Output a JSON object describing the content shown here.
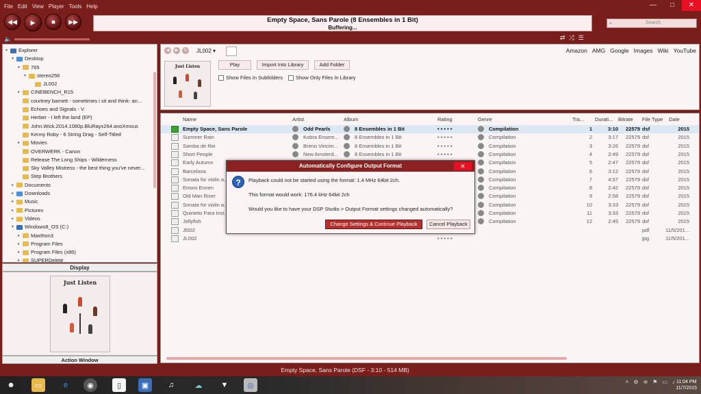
{
  "menu": [
    "File",
    "Edit",
    "View",
    "Player",
    "Tools",
    "Help"
  ],
  "window_controls": {
    "minimize": "—",
    "maximize": "□",
    "close": "✕"
  },
  "transport": {
    "prev": "◀◀",
    "play": "▶",
    "stop": "■",
    "next": "▶▶"
  },
  "now_playing": {
    "title": "Empty Space, Sans Parole (8 Ensembles in 1 Bit)",
    "status": "Buffering..."
  },
  "search": {
    "placeholder": "Search"
  },
  "tree": [
    {
      "label": "Explorer",
      "indent": 0,
      "type": "pc",
      "arrow": "▾"
    },
    {
      "label": "Desktop",
      "indent": 1,
      "type": "blue",
      "arrow": "▾"
    },
    {
      "label": "765",
      "indent": 2,
      "type": "folder",
      "arrow": "▾"
    },
    {
      "label": "stereo256",
      "indent": 3,
      "type": "folder",
      "arrow": "▾"
    },
    {
      "label": "JL002",
      "indent": 4,
      "type": "folder",
      "arrow": ""
    },
    {
      "label": "CINEBENCH_R15",
      "indent": 2,
      "type": "folder",
      "arrow": "▸"
    },
    {
      "label": "courtney barnett - sometimes i sit and think- an...",
      "indent": 2,
      "type": "folder",
      "arrow": ""
    },
    {
      "label": "Echoes and Signals - V",
      "indent": 2,
      "type": "folder",
      "arrow": ""
    },
    {
      "label": "Herber - I left the land (EP)",
      "indent": 2,
      "type": "folder",
      "arrow": ""
    },
    {
      "label": "John.Wick.2014.1080p.BluRayx264.anoXmous",
      "indent": 2,
      "type": "folder",
      "arrow": ""
    },
    {
      "label": "Kenny Roby - 6 String Drag - Self-Titled",
      "indent": 2,
      "type": "folder",
      "arrow": ""
    },
    {
      "label": "Movies",
      "indent": 2,
      "type": "folder",
      "arrow": "▸"
    },
    {
      "label": "OVERWERK - Canon",
      "indent": 2,
      "type": "folder",
      "arrow": ""
    },
    {
      "label": "Release The Long Ships - Wilderness",
      "indent": 2,
      "type": "folder",
      "arrow": ""
    },
    {
      "label": "Sky Valley Mistress - the best thing you've never...",
      "indent": 2,
      "type": "folder",
      "arrow": ""
    },
    {
      "label": "Step Brothers",
      "indent": 2,
      "type": "folder",
      "arrow": ""
    },
    {
      "label": "Documents",
      "indent": 1,
      "type": "folder",
      "arrow": "▸"
    },
    {
      "label": "Downloads",
      "indent": 1,
      "type": "blue",
      "arrow": "▸"
    },
    {
      "label": "Music",
      "indent": 1,
      "type": "folder",
      "arrow": "▸"
    },
    {
      "label": "Pictures",
      "indent": 1,
      "type": "folder",
      "arrow": "▸"
    },
    {
      "label": "Videos",
      "indent": 1,
      "type": "folder",
      "arrow": "▸"
    },
    {
      "label": "Windows8_OS (C:)",
      "indent": 1,
      "type": "pc",
      "arrow": "▾"
    },
    {
      "label": "Maxthon3",
      "indent": 2,
      "type": "folder",
      "arrow": "▸"
    },
    {
      "label": "Program Files",
      "indent": 2,
      "type": "folder",
      "arrow": "▸"
    },
    {
      "label": "Program Files (x86)",
      "indent": 2,
      "type": "folder",
      "arrow": "▸"
    },
    {
      "label": "SUPERDelete",
      "indent": 2,
      "type": "folder",
      "arrow": "▸"
    }
  ],
  "display_panel": {
    "title": "Display",
    "action_title": "Action Window"
  },
  "cover": {
    "title": "Just Listen"
  },
  "breadcrumb": "JL002 ▾",
  "links": [
    "Amazon",
    "AMG",
    "Google",
    "Images",
    "Wiki",
    "YouTube"
  ],
  "buttons": {
    "play": "Play",
    "import": "Import Into Library",
    "add_folder": "Add Folder"
  },
  "checks": {
    "subfolders": "Show Files In Subfolders",
    "only_library": "Show Only Files In Library"
  },
  "columns": {
    "name": "Name",
    "artist": "Artist",
    "album": "Album",
    "rating": "Rating",
    "genre": "Genre",
    "track": "Tra...",
    "duration": "Durati...",
    "bitrate": "Bitrate",
    "filetype": "File Type",
    "date": "Date"
  },
  "tracks": [
    {
      "name": "Empty Space, Sans Parole",
      "artist": "Odd Pearls",
      "album": "8 Ensembles in 1 Bit",
      "rating": "• • • • •",
      "genre": "Compilation",
      "track": "1",
      "duration": "3:10",
      "bitrate": "22579",
      "type": "dsf",
      "date": "2015"
    },
    {
      "name": "Summer Rain",
      "artist": "Kobra Ensem...",
      "album": "8 Ensembles in 1 Bit",
      "rating": "• • • • •",
      "genre": "Compilation",
      "track": "2",
      "duration": "3:17",
      "bitrate": "22579",
      "type": "dsf",
      "date": "2015"
    },
    {
      "name": "Samba de Rei",
      "artist": "Breno Viricim...",
      "album": "8 Ensembles in 1 Bit",
      "rating": "• • • • •",
      "genre": "Compilation",
      "track": "3",
      "duration": "3:26",
      "bitrate": "22579",
      "type": "dsf",
      "date": "2015"
    },
    {
      "name": "Short People",
      "artist": "New Amsterd...",
      "album": "8 Ensembles in 1 Bit",
      "rating": "• • • • •",
      "genre": "Compilation",
      "track": "4",
      "duration": "2:49",
      "bitrate": "22579",
      "type": "dsf",
      "date": "2015"
    },
    {
      "name": "Early Autumn",
      "artist": "",
      "album": "",
      "rating": "",
      "genre": "Compilation",
      "track": "5",
      "duration": "2:47",
      "bitrate": "22579",
      "type": "dsf",
      "date": "2015"
    },
    {
      "name": "Barcelona",
      "artist": "",
      "album": "",
      "rating": "",
      "genre": "Compilation",
      "track": "6",
      "duration": "3:12",
      "bitrate": "22579",
      "type": "dsf",
      "date": "2015"
    },
    {
      "name": "Sonata for violin a...",
      "artist": "",
      "album": "",
      "rating": "",
      "genre": "Compilation",
      "track": "7",
      "duration": "4:57",
      "bitrate": "22579",
      "type": "dsf",
      "date": "2015"
    },
    {
      "name": "Emoni Ennen",
      "artist": "",
      "album": "",
      "rating": "",
      "genre": "Compilation",
      "track": "8",
      "duration": "2:42",
      "bitrate": "22579",
      "type": "dsf",
      "date": "2015"
    },
    {
      "name": "Old Man River",
      "artist": "",
      "album": "",
      "rating": "",
      "genre": "Compilation",
      "track": "9",
      "duration": "2:58",
      "bitrate": "22579",
      "type": "dsf",
      "date": "2015"
    },
    {
      "name": "Sonata for violin a...",
      "artist": "",
      "album": "",
      "rating": "",
      "genre": "Compilation",
      "track": "10",
      "duration": "3:33",
      "bitrate": "22579",
      "type": "dsf",
      "date": "2015"
    },
    {
      "name": "Quinteto Para Inst...",
      "artist": "",
      "album": "",
      "rating": "",
      "genre": "Compilation",
      "track": "11",
      "duration": "3:33",
      "bitrate": "22579",
      "type": "dsf",
      "date": "2015"
    },
    {
      "name": "Jellyfish",
      "artist": "",
      "album": "",
      "rating": "",
      "genre": "Compilation",
      "track": "12",
      "duration": "2:45",
      "bitrate": "22579",
      "type": "dsf",
      "date": "2015"
    },
    {
      "name": "Jl002",
      "artist": "",
      "album": "",
      "rating": "• • • • •",
      "genre": "",
      "track": "",
      "duration": "",
      "bitrate": "",
      "type": "pdf",
      "date": "11/5/201..."
    },
    {
      "name": "JL002",
      "artist": "",
      "album": "",
      "rating": "• • • • •",
      "genre": "",
      "track": "",
      "duration": "",
      "bitrate": "",
      "type": "jpg",
      "date": "11/5/201..."
    }
  ],
  "status_bar": "Empty Space, Sans Parole (DSF - 3:10 - 514 MB)",
  "dialog": {
    "title": "Automatically Configure Output Format",
    "line1": "Playback could not be started using the format: 1.4 MHz 64bit 2ch.",
    "line2": "This format would work: 176.4 kHz 64bit 2ch",
    "line3": "Would you like to have your DSP Studio > Output Format settings changed automatically?",
    "confirm": "Change Settings & Continue Playback",
    "cancel": "Cancel Playback",
    "icon": "?"
  },
  "clock": {
    "time": "11:04 PM",
    "date": "11/7/2015"
  },
  "colors": {
    "chrome": "#7a1e1c",
    "dialog_title": "#8b2221",
    "accent": "#b4302e"
  }
}
